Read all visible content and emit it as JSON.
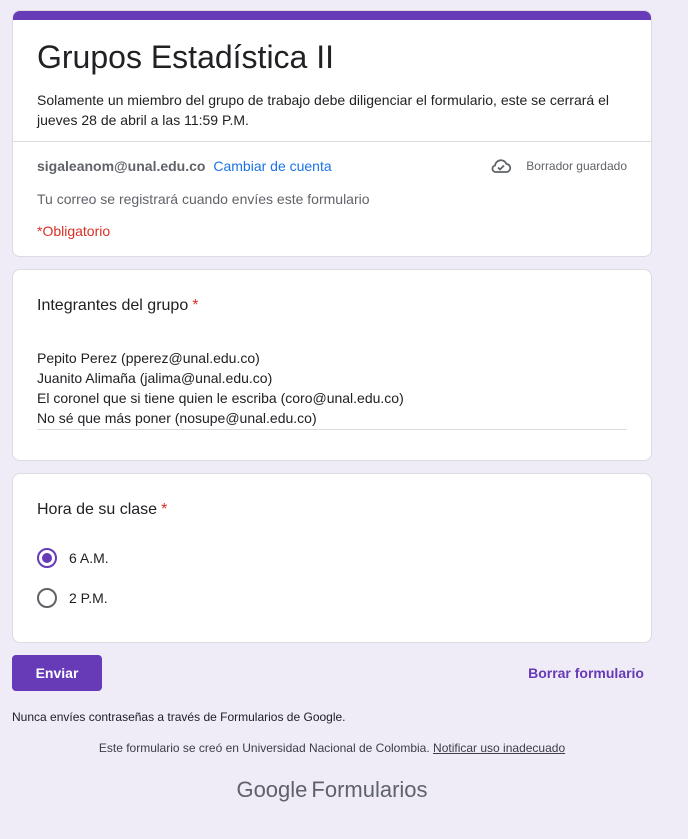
{
  "form": {
    "title": "Grupos Estadística II",
    "description": "Solamente un miembro del grupo de trabajo debe diligenciar el formulario, este se cerrará el jueves 28 de abril a las 11:59 P.M.",
    "account_email": "sigaleanom@unal.edu.co",
    "switch_account": "Cambiar de cuenta",
    "draft_status": "Borrador guardado",
    "email_note": "Tu correo se registrará cuando envíes este formulario",
    "required_note": "*Obligatorio",
    "accent_color": "#673ab7"
  },
  "questions": [
    {
      "title": "Integrantes del grupo",
      "required_mark": "*",
      "answer_lines": [
        "Pepito Perez (pperez@unal.edu.co)",
        "Juanito Alimaña (jalima@unal.edu.co)",
        "El coronel que si tiene quien le escriba (coro@unal.edu.co)",
        "No sé que más poner (nosupe@unal.edu.co)"
      ]
    },
    {
      "title": "Hora de su clase",
      "required_mark": "*",
      "options": [
        {
          "label": "6 A.M.",
          "checked": true
        },
        {
          "label": "2 P.M.",
          "checked": false
        }
      ]
    }
  ],
  "actions": {
    "submit": "Enviar",
    "clear": "Borrar formulario"
  },
  "footer": {
    "password_note": "Nunca envíes contraseñas a través de Formularios de Google.",
    "created_note": "Este formulario se creó en Universidad Nacional de Colombia.",
    "report_link": "Notificar uso inadecuado",
    "logo_google": "Google",
    "logo_forms": "Formularios"
  }
}
